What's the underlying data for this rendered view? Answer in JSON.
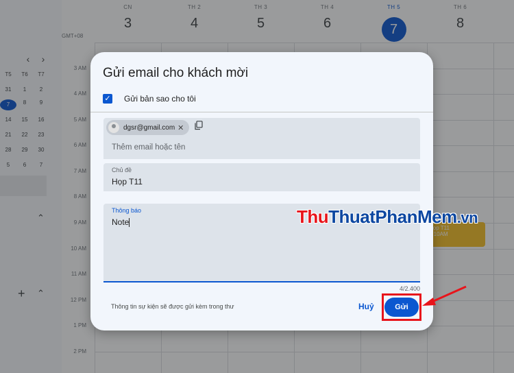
{
  "calendar": {
    "timezone": "GMT+08",
    "days": [
      {
        "name": "CN",
        "num": "3"
      },
      {
        "name": "TH 2",
        "num": "4"
      },
      {
        "name": "TH 3",
        "num": "5"
      },
      {
        "name": "TH 4",
        "num": "6"
      },
      {
        "name": "TH 5",
        "num": "7"
      },
      {
        "name": "TH 6",
        "num": "8"
      }
    ],
    "hours": [
      "3 AM",
      "4 AM",
      "5 AM",
      "6 AM",
      "7 AM",
      "8 AM",
      "9 AM",
      "10 AM",
      "11 AM",
      "12 PM",
      "1 PM",
      "2 PM"
    ],
    "mini": {
      "head": [
        "T5",
        "T6",
        "T7"
      ],
      "rows": [
        [
          "31",
          "1",
          "2"
        ],
        [
          "7",
          "8",
          "9"
        ],
        [
          "14",
          "15",
          "16"
        ],
        [
          "21",
          "22",
          "23"
        ],
        [
          "28",
          "29",
          "30"
        ],
        [
          "5",
          "6",
          "7"
        ]
      ]
    },
    "event": {
      "line1": "Họp T11",
      "line2": "– 10AM"
    }
  },
  "dialog": {
    "title": "Gửi email cho khách mời",
    "copy_self_label": "Gửi bản sao cho tôi",
    "guest_chip": "dgsr@gmail.com",
    "guest_placeholder": "Thêm email hoặc tên",
    "subject_label": "Chủ đề",
    "subject_value": "Họp T11",
    "message_label": "Thông báo",
    "message_value": "Note",
    "counter": "4/2.400",
    "footer_note": "Thông tin sự kiện sẽ được gửi kèm trong thư",
    "cancel_label": "Huỷ",
    "send_label": "Gửi"
  },
  "watermark": {
    "part1": "Thu",
    "part2": "ThuatPhanMem",
    "part3": ".vn"
  },
  "colors": {
    "accent": "#0b57d0",
    "highlight": "#e8141b",
    "event": "#f6bf26"
  }
}
